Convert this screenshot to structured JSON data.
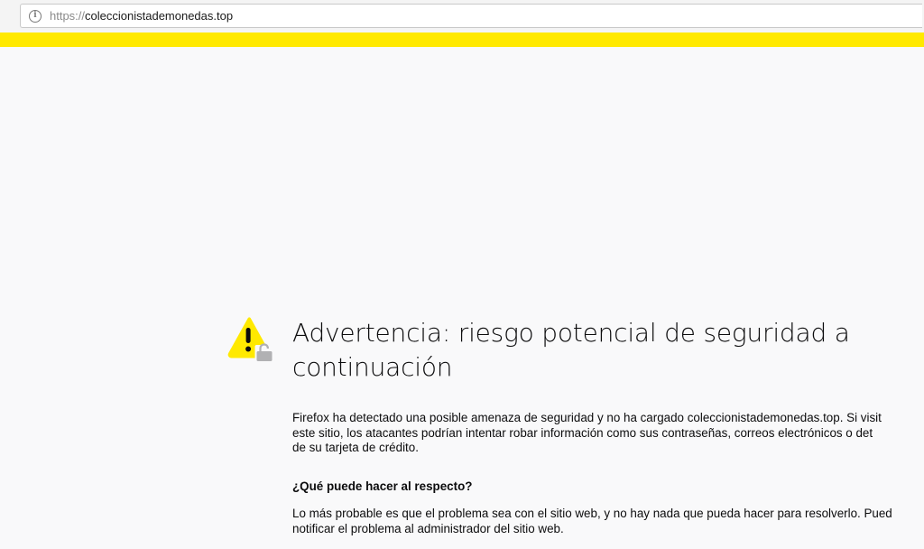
{
  "browser": {
    "url_scheme": "https://",
    "url_host": "coleccionistademonedas.top",
    "site_info_icon": "info-icon"
  },
  "colors": {
    "warning_strip": "#ffe900",
    "page_background": "#f9f9fa",
    "warning_triangle": "#ffe900",
    "lock": "#b1b1b3"
  },
  "error_page": {
    "icon": "warning-lock-icon",
    "title": "Advertencia: riesgo potencial de seguridad a continuación",
    "intro_lines": [
      "Firefox ha detectado una posible amenaza de seguridad y no ha cargado coleccionistademonedas.top. Si visit",
      "este sitio, los atacantes podrían intentar robar información como sus contraseñas, correos electrónicos o det",
      "de su tarjeta de crédito."
    ],
    "what_can_you_do_heading": "¿Qué puede hacer al respecto?",
    "explanation_lines": [
      "Lo más probable es que el problema sea con el sitio web, y no hay nada que pueda hacer para resolverlo. Pued",
      "notificar el problema al administrador del sitio web."
    ]
  }
}
